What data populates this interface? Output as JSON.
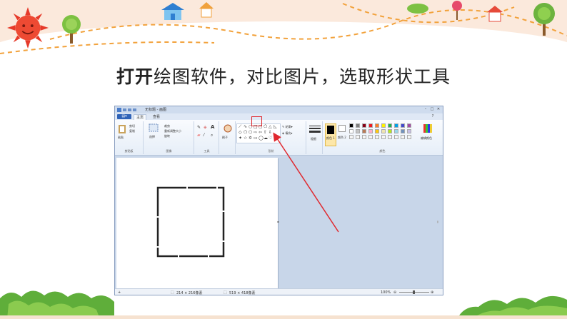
{
  "slide": {
    "title_bold": "打开",
    "title_rest": "绘图软件，对比图片，选取形状工具"
  },
  "paint": {
    "window_title": "无标题 - 画图",
    "tabs": [
      "主页",
      "查看"
    ],
    "groups": [
      "剪贴板",
      "图像",
      "工具",
      "形状",
      "颜色"
    ],
    "clipboard": {
      "paste": "粘贴",
      "cut": "剪切",
      "copy": "复制"
    },
    "image": {
      "select": "选择",
      "crop": "裁剪",
      "resize": "重新调整大小",
      "rotate": "旋转"
    },
    "brush": "刷子",
    "shapes": {
      "outline": "轮廓",
      "fill": "填充"
    },
    "size_label": "粗细",
    "color1": "颜色 1",
    "color2": "颜色 2",
    "edit_colors": "编辑颜色",
    "status": {
      "selection": "214 × 216像素",
      "canvas_size": "519 × 418像素",
      "zoom": "100%"
    },
    "palette": [
      "#000000",
      "#7f7f7f",
      "#880015",
      "#ed1c24",
      "#ff7f27",
      "#fff200",
      "#22b14c",
      "#00a2e8",
      "#3f48cc",
      "#a349a4",
      "#ffffff",
      "#c3c3c3",
      "#b97a57",
      "#ffaec9",
      "#ffc90e",
      "#efe4b0",
      "#b5e61d",
      "#99d9ea",
      "#7092be",
      "#c8bfe7"
    ]
  },
  "colors": {
    "highlight": "#e0282e",
    "accent": "#2f63b8"
  }
}
